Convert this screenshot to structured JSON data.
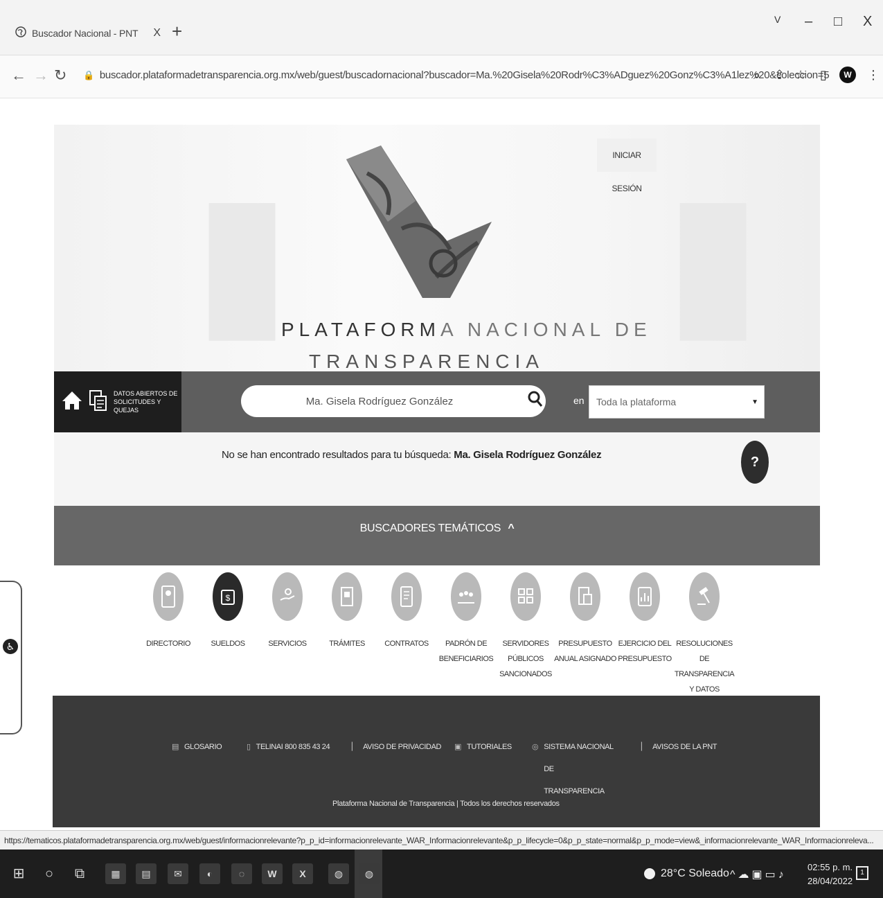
{
  "browser": {
    "tab_title": "Buscador Nacional - PNT",
    "tab_close": "X",
    "new_tab": "+",
    "win_chevron": "V",
    "win_minimize": "–",
    "win_maximize": "□",
    "win_close": "X",
    "url": "buscador.plataformadetransparencia.org.mx/web/guest/buscadornacional?buscador=Ma.%20Gisela%20Rodr%C3%ADguez%20Gonz%C3%A1lez%20&coleccion=5",
    "profile_initial": "W"
  },
  "header": {
    "login_label": "INICIAR SESIÓN",
    "brand_line1_a": "PLATAFORM",
    "brand_line1_b": "A NACIONAL DE",
    "brand_line2": "TRANSPARENCIA"
  },
  "search": {
    "home_label_line1": "DATOS ABIERTOS DE",
    "home_label_line2": "SOLICITUDES Y QUEJAS",
    "query": "Ma. Gisela Rodríguez González",
    "en_label": "en",
    "scope_value": "Toda la plataforma"
  },
  "results": {
    "no_results_prefix": "No se han encontrado resultados para tu búsqueda:",
    "query_bold": "Ma. Gisela Rodríguez González",
    "help_label": "?"
  },
  "thematic": {
    "title": "BUSCADORES TEMÁTICOS",
    "chevron": "^",
    "items": [
      {
        "label": "DIRECTORIO"
      },
      {
        "label": "SUELDOS"
      },
      {
        "label": "SERVICIOS"
      },
      {
        "label": "TRÁMITES"
      },
      {
        "label": "CONTRATOS"
      },
      {
        "label": "PADRÓN DE BENEFICIARIOS"
      },
      {
        "label": "SERVIDORES PÚBLICOS SANCIONADOS"
      },
      {
        "label": "PRESUPUESTO ANUAL ASIGNADO"
      },
      {
        "label": "EJERCICIO DEL PRESUPUESTO"
      },
      {
        "label": "RESOLUCIONES DE TRANSPARENCIA Y DATOS"
      }
    ]
  },
  "footer": {
    "links": [
      {
        "label": "GLOSARIO"
      },
      {
        "label": "TELINAI 800 835 43 24"
      },
      {
        "label": "AVISO DE PRIVACIDAD"
      },
      {
        "label": "TUTORIALES"
      },
      {
        "label": "SISTEMA NACIONAL DE TRANSPARENCIA"
      },
      {
        "label": "AVISOS DE LA PNT"
      }
    ],
    "copyright": "Plataforma Nacional de Transparencia | Todos los derechos reservados"
  },
  "status_url": "https://tematicos.plataformadetransparencia.org.mx/web/guest/informacionrelevante?p_p_id=informacionrelevante_WAR_Informacionrelevante&p_p_lifecycle=0&p_p_state=normal&p_p_mode=view&_informacionrelevante_WAR_Informacionreleva...",
  "taskbar": {
    "weather": "28°C Soleado",
    "time": "02:55 p. m.",
    "date": "28/04/2022",
    "notifications": "1"
  }
}
